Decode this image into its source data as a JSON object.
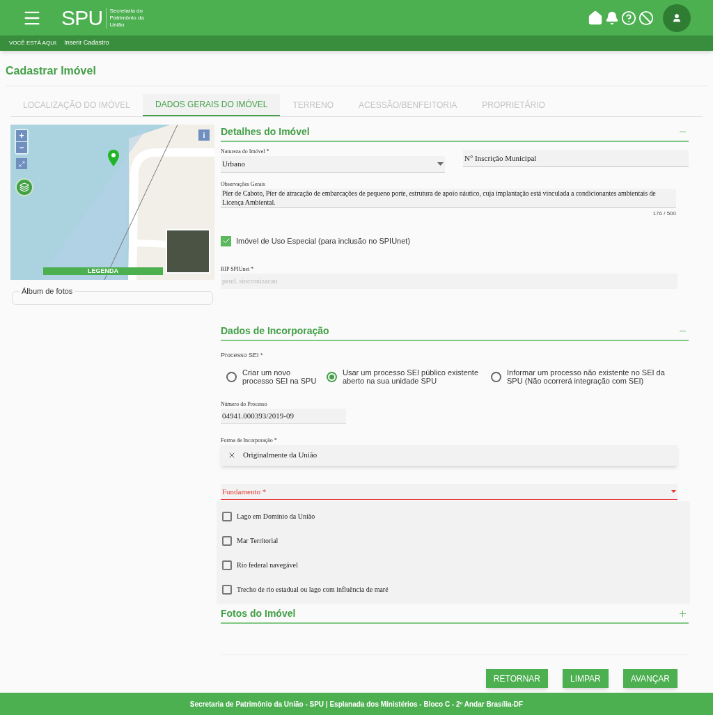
{
  "header": {
    "logo": "SPU",
    "logo_subtitle": "Secretaria do Patrimônio da União"
  },
  "breadcrumb": {
    "label": "VOCÊ ESTÁ AQUI:",
    "current": "Inserir Cadastro"
  },
  "page_title": "Cadastrar Imóvel",
  "tabs": [
    {
      "label": "LOCALIZAÇÃO DO IMÓVEL",
      "selected": false
    },
    {
      "label": "DADOS GERAIS DO IMÓVEL",
      "selected": true
    },
    {
      "label": "TERRENO",
      "selected": false
    },
    {
      "label": "ACESSÃO/BENFEITORIA",
      "selected": false
    },
    {
      "label": "PROPRIETÁRIO",
      "selected": false
    }
  ],
  "map": {
    "legend_button": "LEGENDA",
    "zoom_in": "+",
    "zoom_out": "−",
    "info": "i"
  },
  "album": {
    "label": "Álbum de fotos"
  },
  "details": {
    "title": "Detalhes do Imóvel",
    "expanded": true,
    "natureza": {
      "label": "Natureza do Imóvel *",
      "value": "Urbano"
    },
    "inscricao": {
      "placeholder": "N° Inscrição Municipal"
    },
    "observacoes": {
      "label": "Observações Gerais",
      "value": "Píer de Caboto, Píer de atracação de embarcações de pequeno porte, estrutura de apoio náutico, cuja implantação está vinculada a condicionantes ambientais de Licença Ambiental.",
      "counter": "176 / 500"
    },
    "uso_especial": {
      "label": "Imóvel de Uso Especial (para inclusão no SPIUnet)",
      "checked": true
    },
    "rip": {
      "label": "RIP SPIUnet *",
      "value": "pend. sincronizacao",
      "disabled": true
    }
  },
  "incorporacao": {
    "title": "Dados de Incorporação",
    "expanded": true,
    "processo_label": "Processo SEI *",
    "options": [
      {
        "label": "Criar um novo processo SEI na SPU",
        "selected": false
      },
      {
        "label": "Usar um processo SEI público existente aberto na sua unidade SPU",
        "selected": true
      },
      {
        "label": "Informar um processo não existente no SEI da SPU (Não ocorrerá integração com SEI)",
        "selected": false
      }
    ],
    "numero": {
      "label": "Número do Processo",
      "value": "04941.000393/2019-09"
    },
    "forma": {
      "label": "Forma de Incorporação *",
      "value": "Originalmente da União"
    },
    "fundamento": {
      "label": "Fundamento *",
      "error": true
    },
    "fundamento_options": [
      {
        "label": "Lago em Domínio da União",
        "checked": false
      },
      {
        "label": "Mar Territorial",
        "checked": false
      },
      {
        "label": "Rio federal navegável",
        "checked": false
      },
      {
        "label": "Trecho de rio estadual ou lago com influência de maré",
        "checked": false
      }
    ]
  },
  "fotos": {
    "title": "Fotos do Imóvel",
    "expanded": false
  },
  "buttons": [
    "RETORNAR",
    "LIMPAR",
    "AVANÇAR"
  ],
  "footer": "Secretaria de Patrimônio da União - SPU | Esplanada dos Ministérios - Bloco C - 2º Andar Brasília-DF"
}
